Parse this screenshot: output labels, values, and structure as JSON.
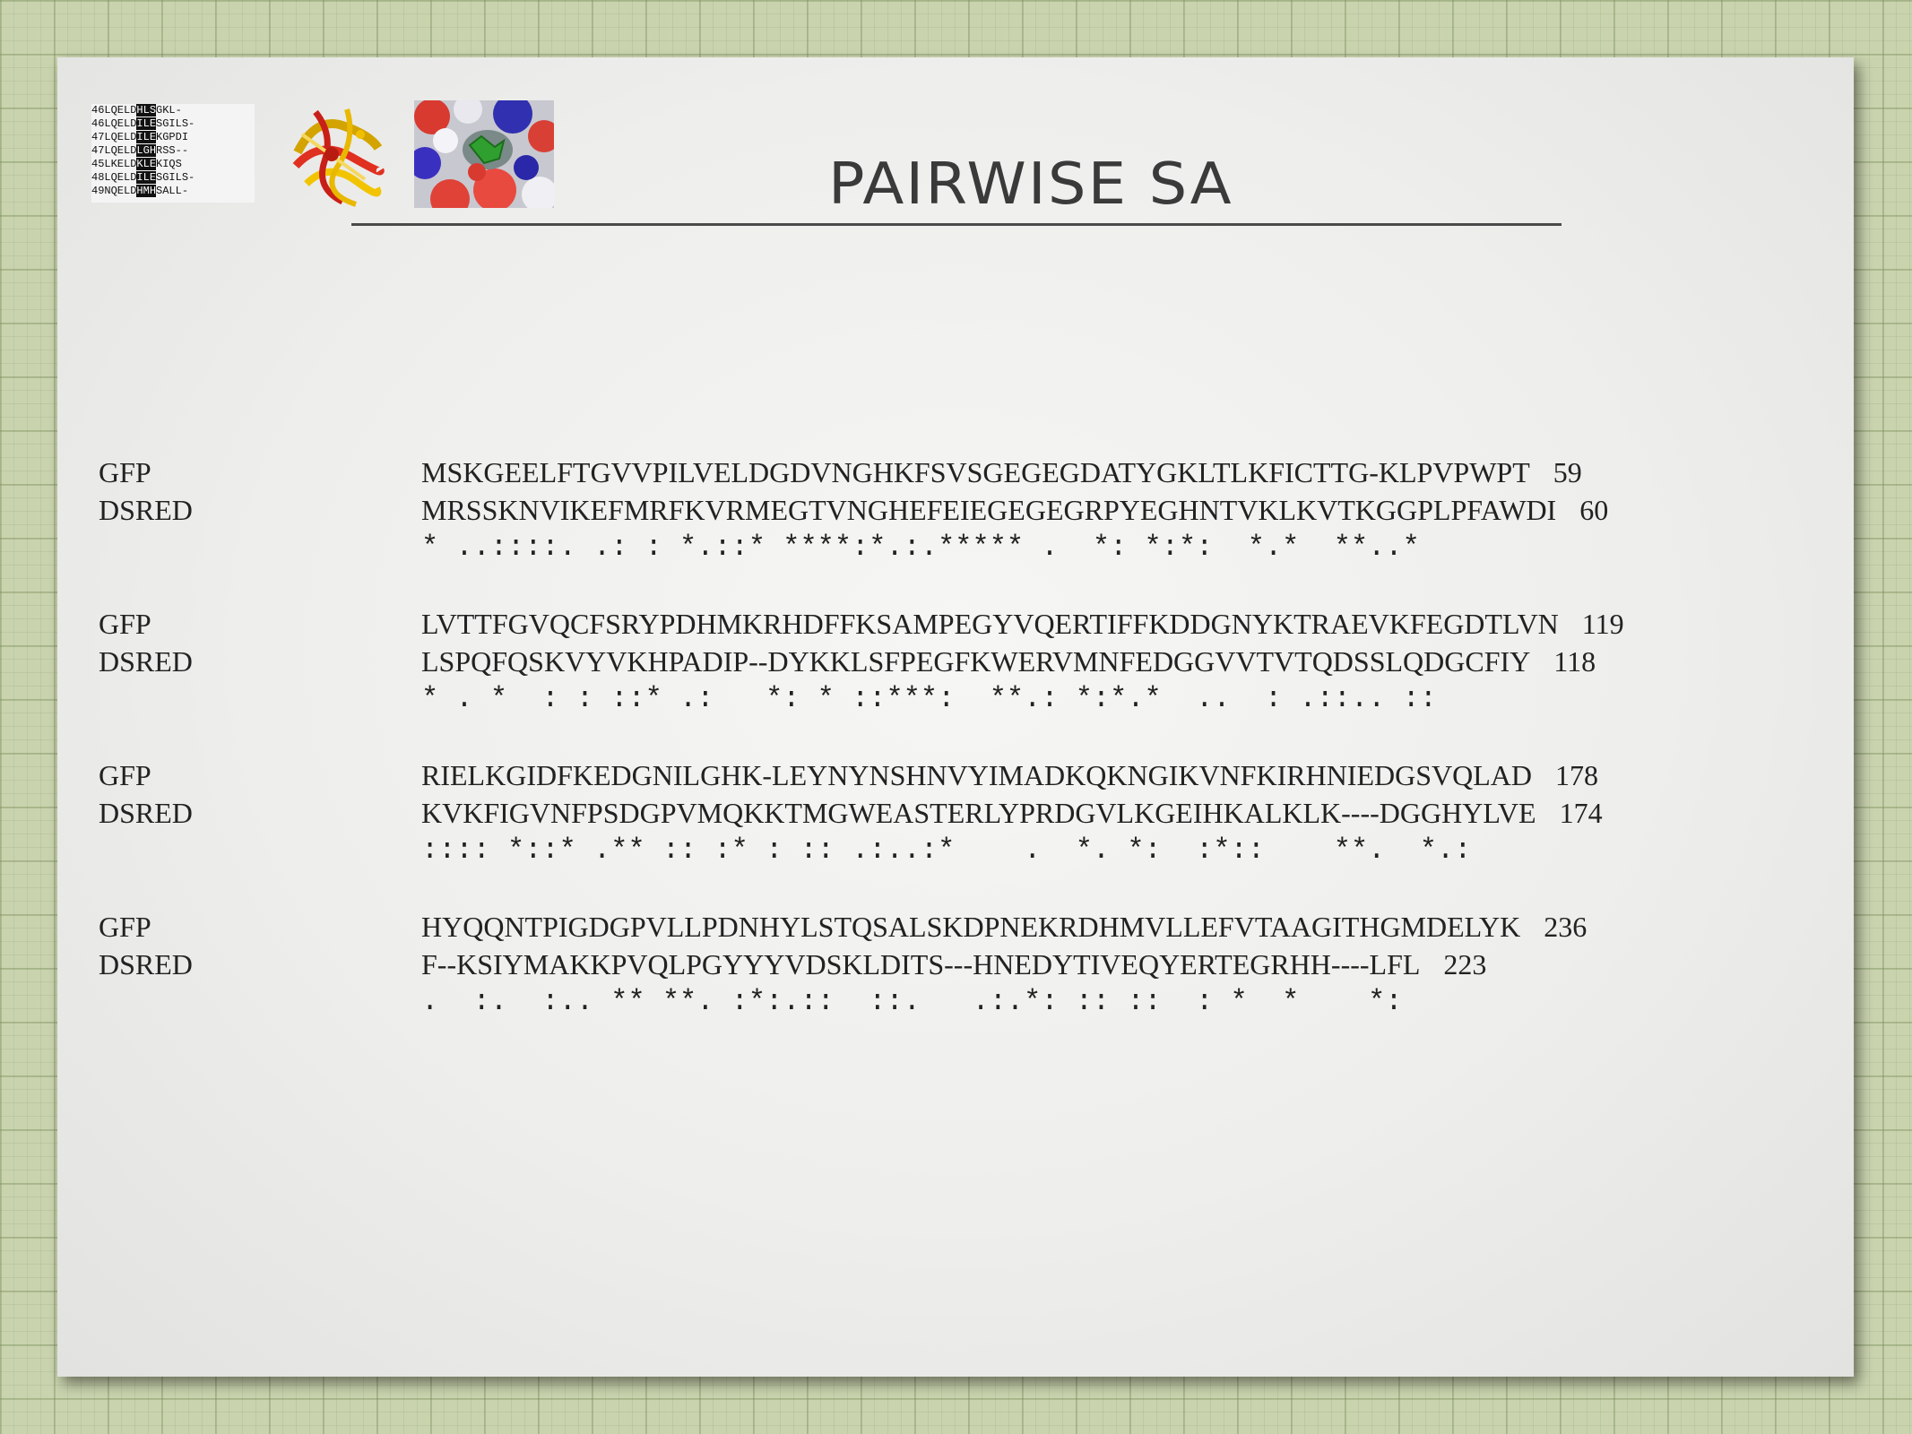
{
  "title": "PAIRWISE SA",
  "thumbnail_alignment": {
    "rows": [
      [
        "46",
        "LQELD",
        "HLS",
        "GKL-"
      ],
      [
        "46",
        "LQELD",
        "ILE",
        "SGILS-"
      ],
      [
        "47",
        "LQELD",
        "ILE",
        "KGPDI"
      ],
      [
        "47",
        "LQELD",
        "LGH",
        "RSS--"
      ],
      [
        "45",
        "LKELD",
        "KLE",
        "KIQS"
      ],
      [
        "48",
        "LQELD",
        "ILE",
        "SGILS-"
      ],
      [
        "49",
        "NQELD",
        "HMH",
        "SALL-"
      ]
    ]
  },
  "blocks": [
    {
      "rows": [
        {
          "label": "GFP",
          "seq": "MSKGEELFTGVVPILVELDGDVNGHKFSVSGEGEGDATYGKLTLKFICTTG-KLPVPWPT",
          "pos": "59"
        },
        {
          "label": "DSRED",
          "seq": "MRSSKNVIKEFMRFKVRMEGTVNGHEFEIEGEGEGRPYEGHNTVKLKVTKGGPLPFAWDI",
          "pos": "60"
        }
      ],
      "conservation": "* ..::::. .: : *.::* ****:*.:.***** .  *: *:*:  *.*  **..*"
    },
    {
      "rows": [
        {
          "label": "GFP",
          "seq": "LVTTFGVQCFSRYPDHMKRHDFFKSAMPEGYVQERTIFFKDDGNYKTRAEVKFEGDTLVN",
          "pos": "119"
        },
        {
          "label": "DSRED",
          "seq": "LSPQFQSKVYVKHPADIP--DYKKLSFPEGFKWERVMNFEDGGVVTVTQDSSLQDGCFIY",
          "pos": "118"
        }
      ],
      "conservation": "* . *  : : ::* .:   *: * ::***:  **.: *:*.*  ..  : .::.. ::"
    },
    {
      "rows": [
        {
          "label": "GFP",
          "seq": "RIELKGIDFKEDGNILGHK-LEYNYNSHNVYIMADKQKNGIKVNFKIRHNIEDGSVQLAD",
          "pos": "178"
        },
        {
          "label": "DSRED",
          "seq": "KVKFIGVNFPSDGPVMQKKTMGWEASTERLYPRDGVLKGEIHKALKLK----DGGHYLVE",
          "pos": "174"
        }
      ],
      "conservation": ":::: *::* .** :: :* : :: .:..:*    .  *. *:  :*::    **.  *.:"
    },
    {
      "rows": [
        {
          "label": "GFP",
          "seq": "HYQQNTPIGDGPVLLPDNHYLSTQSALSKDPNEKRDHMVLLEFVTAAGITHGMDELYK",
          "pos": "236"
        },
        {
          "label": "DSRED",
          "seq": "F--KSIYMAKKPVQLPGYYYVDSKLDITS---HNEDYTIVEQYERTEGRHH----LFL",
          "pos": "223"
        }
      ],
      "conservation": ".  :.  :.. ** **. :*:.::  ::.   .:.*: :: ::  : *  *    *:"
    }
  ]
}
